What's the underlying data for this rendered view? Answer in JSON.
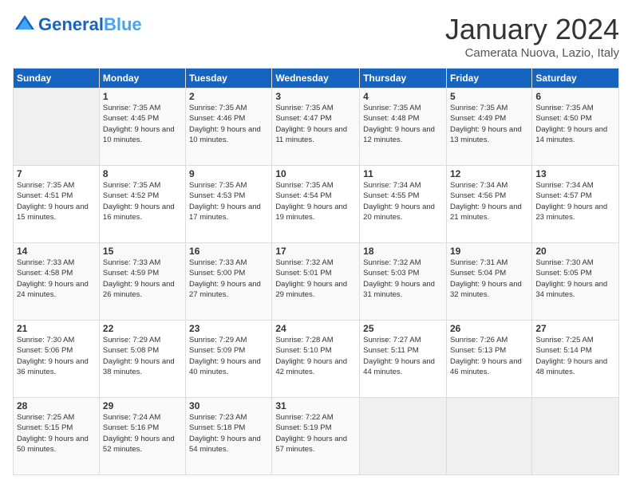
{
  "header": {
    "logo_line1": "General",
    "logo_line2": "Blue",
    "month_title": "January 2024",
    "location": "Camerata Nuova, Lazio, Italy"
  },
  "days_of_week": [
    "Sunday",
    "Monday",
    "Tuesday",
    "Wednesday",
    "Thursday",
    "Friday",
    "Saturday"
  ],
  "weeks": [
    [
      {
        "day": "",
        "info": ""
      },
      {
        "day": "1",
        "info": "Sunrise: 7:35 AM\nSunset: 4:45 PM\nDaylight: 9 hours\nand 10 minutes."
      },
      {
        "day": "2",
        "info": "Sunrise: 7:35 AM\nSunset: 4:46 PM\nDaylight: 9 hours\nand 10 minutes."
      },
      {
        "day": "3",
        "info": "Sunrise: 7:35 AM\nSunset: 4:47 PM\nDaylight: 9 hours\nand 11 minutes."
      },
      {
        "day": "4",
        "info": "Sunrise: 7:35 AM\nSunset: 4:48 PM\nDaylight: 9 hours\nand 12 minutes."
      },
      {
        "day": "5",
        "info": "Sunrise: 7:35 AM\nSunset: 4:49 PM\nDaylight: 9 hours\nand 13 minutes."
      },
      {
        "day": "6",
        "info": "Sunrise: 7:35 AM\nSunset: 4:50 PM\nDaylight: 9 hours\nand 14 minutes."
      }
    ],
    [
      {
        "day": "7",
        "info": "Sunrise: 7:35 AM\nSunset: 4:51 PM\nDaylight: 9 hours\nand 15 minutes."
      },
      {
        "day": "8",
        "info": "Sunrise: 7:35 AM\nSunset: 4:52 PM\nDaylight: 9 hours\nand 16 minutes."
      },
      {
        "day": "9",
        "info": "Sunrise: 7:35 AM\nSunset: 4:53 PM\nDaylight: 9 hours\nand 17 minutes."
      },
      {
        "day": "10",
        "info": "Sunrise: 7:35 AM\nSunset: 4:54 PM\nDaylight: 9 hours\nand 19 minutes."
      },
      {
        "day": "11",
        "info": "Sunrise: 7:34 AM\nSunset: 4:55 PM\nDaylight: 9 hours\nand 20 minutes."
      },
      {
        "day": "12",
        "info": "Sunrise: 7:34 AM\nSunset: 4:56 PM\nDaylight: 9 hours\nand 21 minutes."
      },
      {
        "day": "13",
        "info": "Sunrise: 7:34 AM\nSunset: 4:57 PM\nDaylight: 9 hours\nand 23 minutes."
      }
    ],
    [
      {
        "day": "14",
        "info": "Sunrise: 7:33 AM\nSunset: 4:58 PM\nDaylight: 9 hours\nand 24 minutes."
      },
      {
        "day": "15",
        "info": "Sunrise: 7:33 AM\nSunset: 4:59 PM\nDaylight: 9 hours\nand 26 minutes."
      },
      {
        "day": "16",
        "info": "Sunrise: 7:33 AM\nSunset: 5:00 PM\nDaylight: 9 hours\nand 27 minutes."
      },
      {
        "day": "17",
        "info": "Sunrise: 7:32 AM\nSunset: 5:01 PM\nDaylight: 9 hours\nand 29 minutes."
      },
      {
        "day": "18",
        "info": "Sunrise: 7:32 AM\nSunset: 5:03 PM\nDaylight: 9 hours\nand 31 minutes."
      },
      {
        "day": "19",
        "info": "Sunrise: 7:31 AM\nSunset: 5:04 PM\nDaylight: 9 hours\nand 32 minutes."
      },
      {
        "day": "20",
        "info": "Sunrise: 7:30 AM\nSunset: 5:05 PM\nDaylight: 9 hours\nand 34 minutes."
      }
    ],
    [
      {
        "day": "21",
        "info": "Sunrise: 7:30 AM\nSunset: 5:06 PM\nDaylight: 9 hours\nand 36 minutes."
      },
      {
        "day": "22",
        "info": "Sunrise: 7:29 AM\nSunset: 5:08 PM\nDaylight: 9 hours\nand 38 minutes."
      },
      {
        "day": "23",
        "info": "Sunrise: 7:29 AM\nSunset: 5:09 PM\nDaylight: 9 hours\nand 40 minutes."
      },
      {
        "day": "24",
        "info": "Sunrise: 7:28 AM\nSunset: 5:10 PM\nDaylight: 9 hours\nand 42 minutes."
      },
      {
        "day": "25",
        "info": "Sunrise: 7:27 AM\nSunset: 5:11 PM\nDaylight: 9 hours\nand 44 minutes."
      },
      {
        "day": "26",
        "info": "Sunrise: 7:26 AM\nSunset: 5:13 PM\nDaylight: 9 hours\nand 46 minutes."
      },
      {
        "day": "27",
        "info": "Sunrise: 7:25 AM\nSunset: 5:14 PM\nDaylight: 9 hours\nand 48 minutes."
      }
    ],
    [
      {
        "day": "28",
        "info": "Sunrise: 7:25 AM\nSunset: 5:15 PM\nDaylight: 9 hours\nand 50 minutes."
      },
      {
        "day": "29",
        "info": "Sunrise: 7:24 AM\nSunset: 5:16 PM\nDaylight: 9 hours\nand 52 minutes."
      },
      {
        "day": "30",
        "info": "Sunrise: 7:23 AM\nSunset: 5:18 PM\nDaylight: 9 hours\nand 54 minutes."
      },
      {
        "day": "31",
        "info": "Sunrise: 7:22 AM\nSunset: 5:19 PM\nDaylight: 9 hours\nand 57 minutes."
      },
      {
        "day": "",
        "info": ""
      },
      {
        "day": "",
        "info": ""
      },
      {
        "day": "",
        "info": ""
      }
    ]
  ]
}
